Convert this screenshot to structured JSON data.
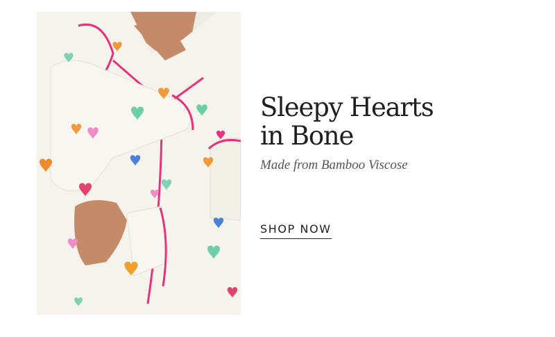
{
  "hero": {
    "headline_line1": "Sleepy Hearts",
    "headline_line2": "in Bone",
    "subline": "Made from Bamboo Viscose",
    "cta_label": "SHOP NOW"
  },
  "colors": {
    "fabric": "#f6f3ec",
    "piping": "#e8317a",
    "text": "#1f1f1f",
    "subtext": "#555555",
    "skin": "#c8906f"
  }
}
